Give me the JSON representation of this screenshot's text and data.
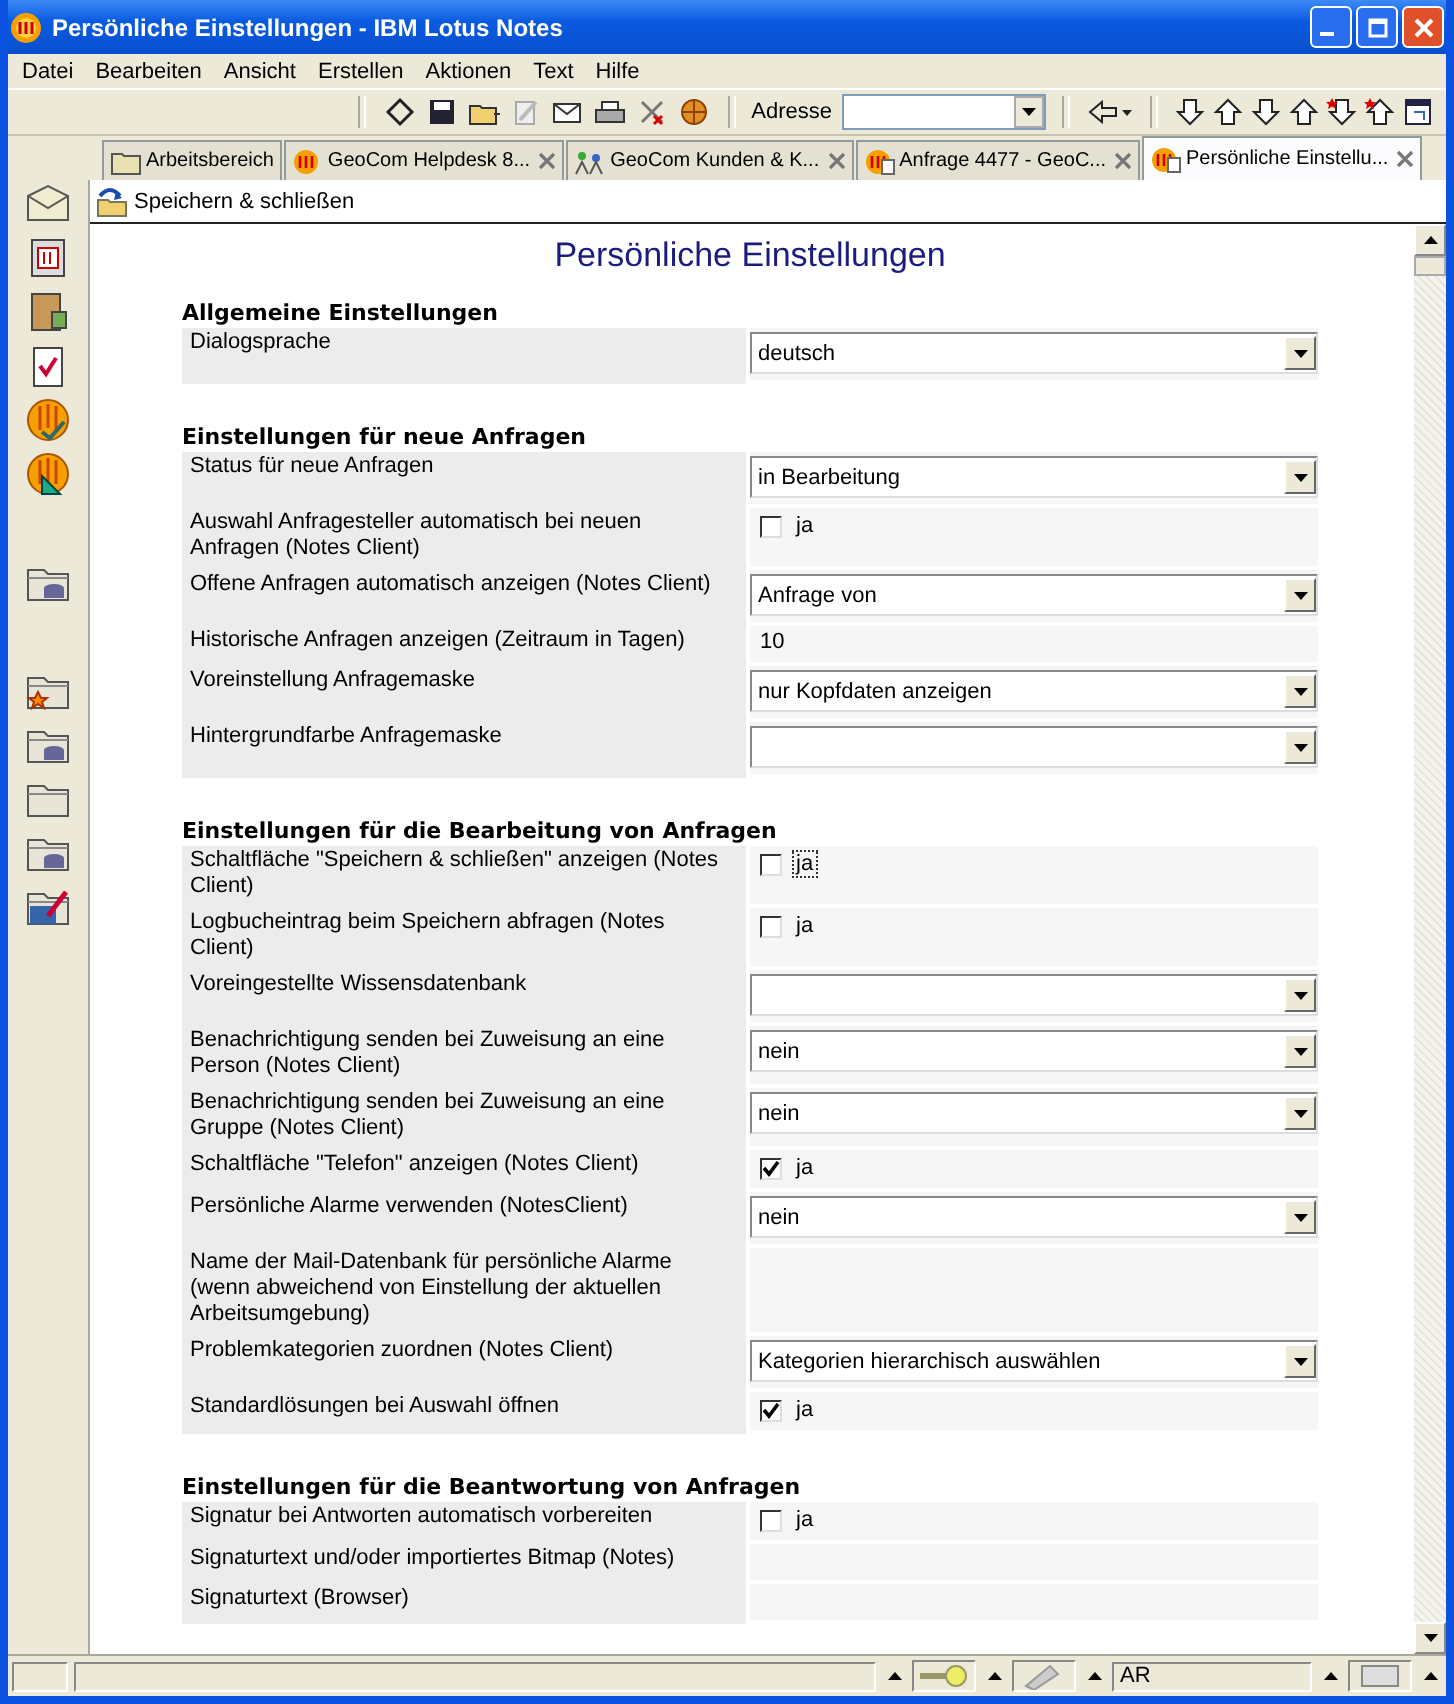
{
  "window": {
    "title": "Persönliche Einstellungen - IBM Lotus Notes"
  },
  "menu": [
    "Datei",
    "Bearbeiten",
    "Ansicht",
    "Erstellen",
    "Aktionen",
    "Text",
    "Hilfe"
  ],
  "toolbar": {
    "address_label": "Adresse"
  },
  "tabs": [
    {
      "label": "Arbeitsbereich",
      "selected": false,
      "closable": false
    },
    {
      "label": "GeoCom Helpdesk 8...",
      "selected": false,
      "closable": true
    },
    {
      "label": "GeoCom Kunden & K...",
      "selected": false,
      "closable": true
    },
    {
      "label": "Anfrage 4477 - GeoC...",
      "selected": false,
      "closable": true
    },
    {
      "label": "Persönliche Einstellu...",
      "selected": true,
      "closable": true
    }
  ],
  "action_bar": {
    "button": "Speichern & schließen"
  },
  "document": {
    "title": "Persönliche Einstellungen",
    "sections": [
      {
        "title": "Allgemeine Einstellungen",
        "rows": [
          {
            "label": "Dialogsprache",
            "kind": "select",
            "value": "deutsch"
          }
        ]
      },
      {
        "title": "Einstellungen für neue Anfragen",
        "rows": [
          {
            "label": "Status für neue Anfragen",
            "kind": "select",
            "value": "in Bearbeitung"
          },
          {
            "label": "Auswahl Anfragesteller automatisch bei neuen Anfragen (Notes Client)",
            "kind": "checkbox",
            "option": "ja",
            "checked": false,
            "focused": false
          },
          {
            "label": "Offene Anfragen automatisch anzeigen (Notes Client)",
            "kind": "select",
            "value": "Anfrage von"
          },
          {
            "label": "Historische Anfragen anzeigen (Zeitraum in Tagen)",
            "kind": "text",
            "value": "10"
          },
          {
            "label": "Voreinstellung Anfragemaske",
            "kind": "select",
            "value": "nur Kopfdaten anzeigen"
          },
          {
            "label": "Hintergrundfarbe Anfragemaske",
            "kind": "select"
          }
        ]
      },
      {
        "title": "Einstellungen für die Bearbeitung von Anfragen",
        "rows": [
          {
            "label": "Schaltfläche \"Speichern & schließen\" anzeigen (Notes Client)",
            "kind": "checkbox",
            "option": "ja",
            "checked": false,
            "focused": true
          },
          {
            "label": "Logbucheintrag beim Speichern abfragen (Notes Client)",
            "kind": "checkbox",
            "option": "ja",
            "checked": false,
            "focused": false
          },
          {
            "label": "Voreingestellte Wissensdatenbank",
            "kind": "select"
          },
          {
            "label": "Benachrichtigung senden bei Zuweisung an eine Person (Notes Client)",
            "kind": "select",
            "value": "nein"
          },
          {
            "label": "Benachrichtigung senden bei Zuweisung an eine Gruppe (Notes Client)",
            "kind": "select",
            "value": "nein"
          },
          {
            "label": "Schaltfläche \"Telefon\" anzeigen (Notes Client)",
            "kind": "checkbox",
            "option": "ja",
            "checked": true,
            "focused": false
          },
          {
            "label": "Persönliche Alarme verwenden (NotesClient)",
            "kind": "select",
            "value": "nein"
          },
          {
            "label": "Name der Mail-Datenbank für persönliche Alarme (wenn abweichend von Einstellung der aktuellen Arbeitsumgebung)",
            "kind": "text"
          },
          {
            "label": "Problemkategorien zuordnen (Notes Client)",
            "kind": "select",
            "value": "Kategorien hierarchisch auswählen"
          },
          {
            "label": "Standardlösungen bei Auswahl öffnen",
            "kind": "checkbox",
            "option": "ja",
            "checked": true,
            "focused": false
          }
        ]
      },
      {
        "title": "Einstellungen für die Beantwortung von Anfragen",
        "rows": [
          {
            "label": "Signatur bei Antworten automatisch vorbereiten",
            "kind": "checkbox",
            "option": "ja",
            "checked": false,
            "focused": false
          },
          {
            "label": "Signaturtext und/oder importiertes Bitmap (Notes)",
            "kind": "text"
          },
          {
            "label": "Signaturtext (Browser)",
            "kind": "text"
          }
        ]
      }
    ]
  },
  "status_bar": {
    "location": "AR"
  }
}
